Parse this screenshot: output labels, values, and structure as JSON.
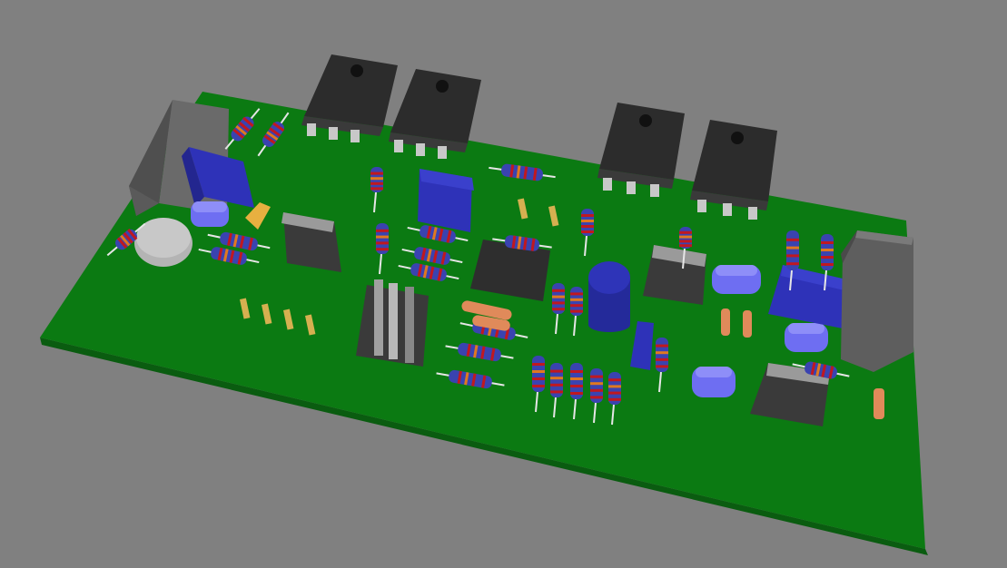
{
  "scene": {
    "background_color": "#808080",
    "board_color": "#0b7a12",
    "board_edge_color": "#0a5c10",
    "colors": {
      "transistor_body": "#2c2c2c",
      "transistor_tab": "#3a3a3a",
      "terminal_block": "#5e5e5e",
      "capacitor_blue": "#2e32b8",
      "capacitor_light": "#6e6ef2",
      "resistor_body": "#3a43b0",
      "resistor_band_red": "#c01820",
      "resistor_band_orange": "#e07820",
      "diode_orange": "#e08a5a",
      "pin_header": "#d6b050",
      "lead_wire": "#e6e6e6"
    },
    "components": {
      "power_transistors": 4,
      "terminal_blocks": 2,
      "ic_packages": 3,
      "electrolytic_capacitors": 1,
      "film_capacitors": 4,
      "resistors_horizontal": 14,
      "resistors_vertical": 14,
      "pin_headers": 6
    }
  }
}
